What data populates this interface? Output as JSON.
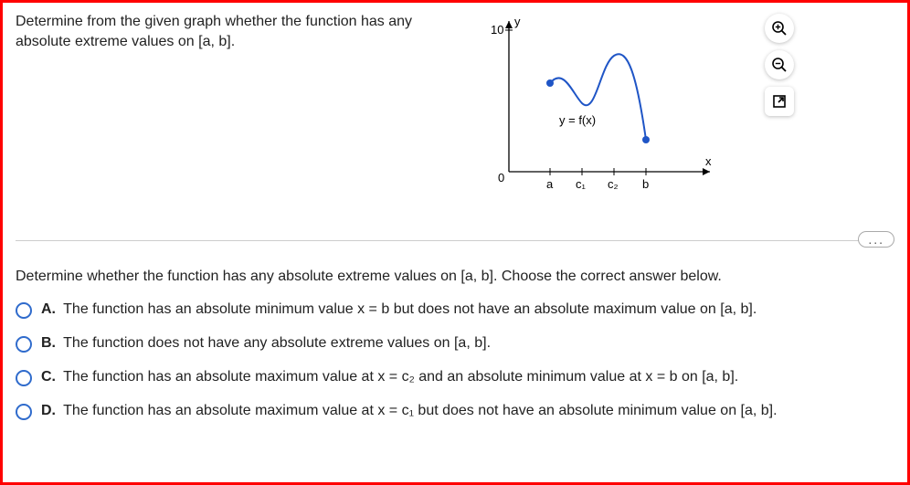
{
  "question": "Determine from the given graph whether the function has any absolute extreme values on [a, b].",
  "instruction": "Determine whether the function has any absolute extreme values on [a, b]. Choose the correct answer below.",
  "graph": {
    "y_label": "y",
    "x_label": "x",
    "origin_label": "0",
    "y_max_label": "10",
    "curve_label": "y = f(x)",
    "x_ticks": [
      "a",
      "c₁",
      "c₂",
      "b"
    ]
  },
  "tools": {
    "zoom_in": "zoom-in",
    "zoom_out": "zoom-out",
    "popout": "popout"
  },
  "more_label": "...",
  "choices": [
    {
      "letter": "A.",
      "text": "The function has an absolute minimum value x = b but does not have an absolute maximum value on [a, b]."
    },
    {
      "letter": "B.",
      "text": "The function does not have any absolute extreme values on [a, b]."
    },
    {
      "letter": "C.",
      "text": "The function has an absolute maximum value at x = c₂ and an absolute minimum value at x = b on [a, b]."
    },
    {
      "letter": "D.",
      "text": "The function has an absolute maximum value at x = c₁ but does not have an absolute minimum value on [a, b]."
    }
  ],
  "chart_data": {
    "type": "line",
    "title": "y = f(x)",
    "xlabel": "x",
    "ylabel": "y",
    "ylim": [
      0,
      10
    ],
    "x_ticks": [
      "a",
      "c1",
      "c2",
      "b"
    ],
    "endpoints": {
      "a": "closed",
      "b": "closed"
    },
    "note": "local max near c2; endpoint at b is lowest visible value; endpoint at a is closed but not the overall maximum",
    "x": [
      "a",
      "c1",
      "c2",
      "b"
    ],
    "y_approx": [
      5.5,
      4.5,
      8.0,
      2.0
    ]
  }
}
